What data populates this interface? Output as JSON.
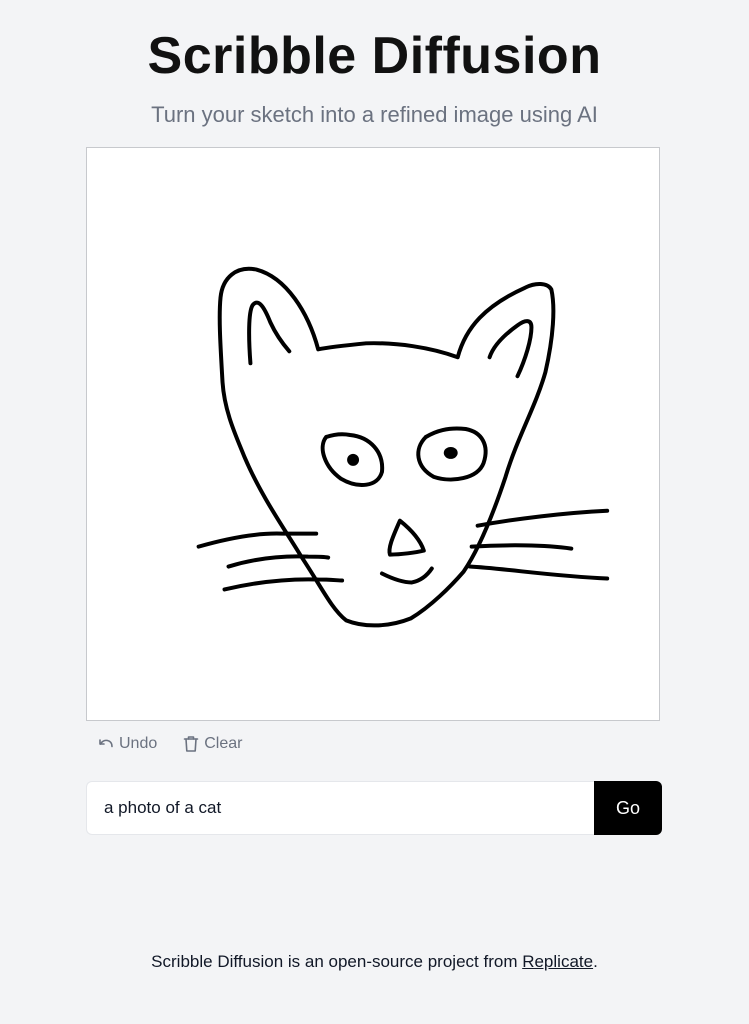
{
  "header": {
    "title": "Scribble Diffusion",
    "subtitle": "Turn your sketch into a refined image using AI"
  },
  "canvas": {
    "background": "#ffffff",
    "stroke_color": "#000000",
    "content": "hand-drawn cat face sketch"
  },
  "tools": {
    "undo_label": "Undo",
    "undo_icon": "undo-arrow-icon",
    "clear_label": "Clear",
    "clear_icon": "trash-icon"
  },
  "prompt": {
    "value": "a photo of a cat",
    "submit_label": "Go"
  },
  "footer": {
    "text_before": "Scribble Diffusion is an open-source project from ",
    "link_label": "Replicate",
    "text_after": "."
  },
  "colors": {
    "page_background": "#f3f4f6",
    "button_background": "#000000",
    "button_text": "#ffffff",
    "muted_text": "#6b7280"
  }
}
